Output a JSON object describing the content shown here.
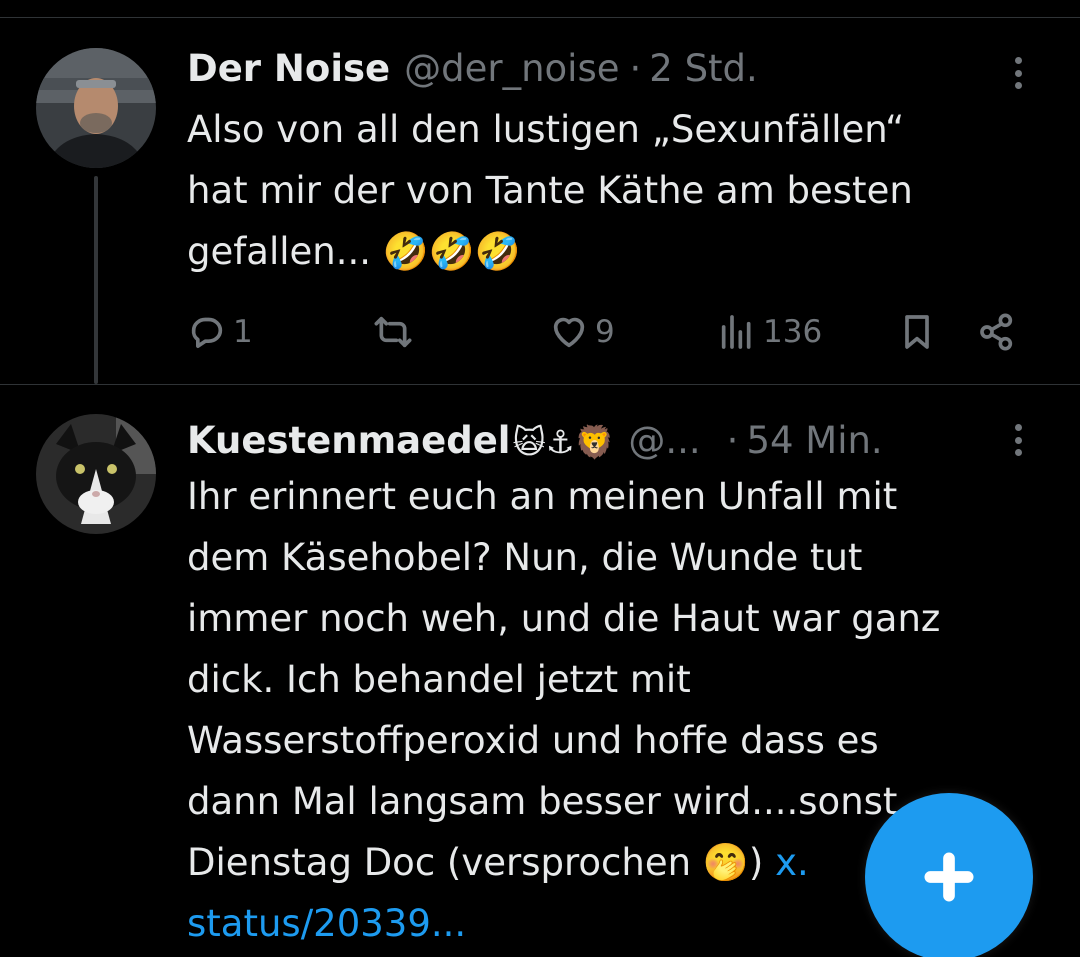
{
  "tweets": [
    {
      "display_name": "Der Noise",
      "handle": "@der_noise",
      "separator": "·",
      "time": "2 Std.",
      "text_lines": [
        "Also von all den lustigen „Sexunfällen“",
        "hat mir der von Tante Käthe am besten",
        "gefallen... 🤣🤣🤣"
      ],
      "stats": {
        "replies": "1",
        "retweets": "",
        "likes": "9",
        "views": "136"
      }
    },
    {
      "display_name": "Kuestenmaedel",
      "name_emojis": "🙀⚓🦁",
      "handle": "@...",
      "separator": "·",
      "time": "54 Min.",
      "text_lines": [
        "Ihr erinnert euch an meinen Unfall mit",
        "dem Käsehobel?  Nun, die Wunde tut",
        "immer noch weh, und die Haut war ganz",
        "dick. Ich behandel jetzt mit",
        "Wasserstoffperoxid und hoffe dass es",
        "dann Mal langsam besser wird....sonst",
        "Dienstag Doc (versprochen 🤭) "
      ],
      "link_inline": "x.",
      "link_line": "status/20339..."
    }
  ],
  "icons": {
    "reply": "reply-icon",
    "retweet": "retweet-icon",
    "like": "heart-icon",
    "views": "views-icon",
    "bookmark": "bookmark-icon",
    "share": "share-icon",
    "more": "more-icon",
    "compose": "plus-icon"
  },
  "colors": {
    "background": "#000000",
    "text": "#e7e9ea",
    "secondary": "#71767b",
    "accent": "#1d9bf0",
    "divider": "#2f3336"
  }
}
